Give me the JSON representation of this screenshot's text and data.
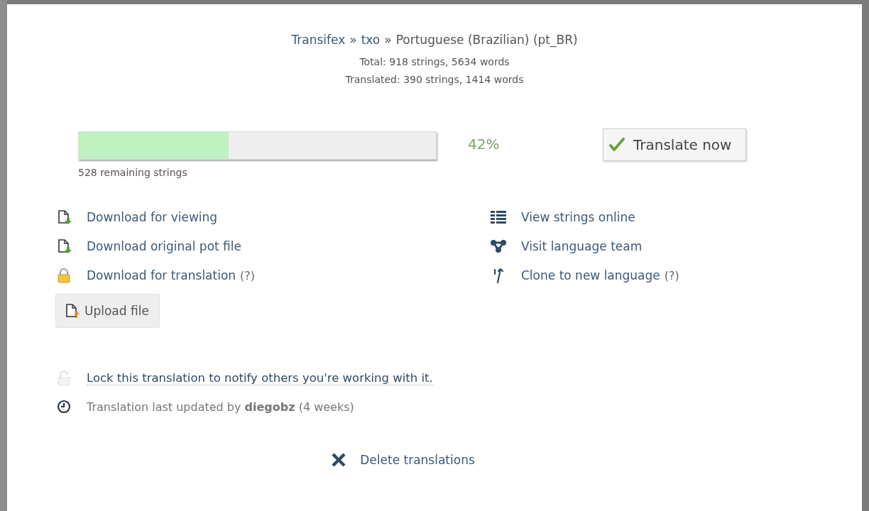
{
  "breadcrumb": [
    {
      "text": "Transifex",
      "kind": "link"
    },
    {
      "text": "»",
      "kind": "separator"
    },
    {
      "text": "txo",
      "kind": "link"
    },
    {
      "text": "»",
      "kind": "separator"
    },
    {
      "text": "Portuguese (Brazilian) (pt_BR)",
      "kind": "current"
    }
  ],
  "stats": [
    "Total: 918 strings, 5634 words",
    "Translated: 390 strings, 1414 words"
  ],
  "progress": {
    "level": 0.42,
    "percent": "42%",
    "remaining": "528 remaining strings"
  },
  "translate_button": "Translate now",
  "left_actions": [
    {
      "label": "Download for viewing",
      "kind": "download"
    },
    {
      "label": "Download original pot file",
      "kind": "download"
    },
    {
      "label": "Download for translation",
      "hint": "(?)",
      "kind": "lock"
    }
  ],
  "upload_button": "Upload file",
  "right_actions": [
    {
      "label": "View strings online",
      "kind": "list"
    },
    {
      "label": "Visit language team",
      "kind": "team"
    },
    {
      "label": "Clone to new language",
      "hint": "(?)",
      "kind": "clone"
    }
  ],
  "lock_link": "Lock this translation to notify others you're working with it.",
  "last_updated": "Translation last updated by **diegobz** (4 weeks)",
  "delete_link": "Delete translations"
}
